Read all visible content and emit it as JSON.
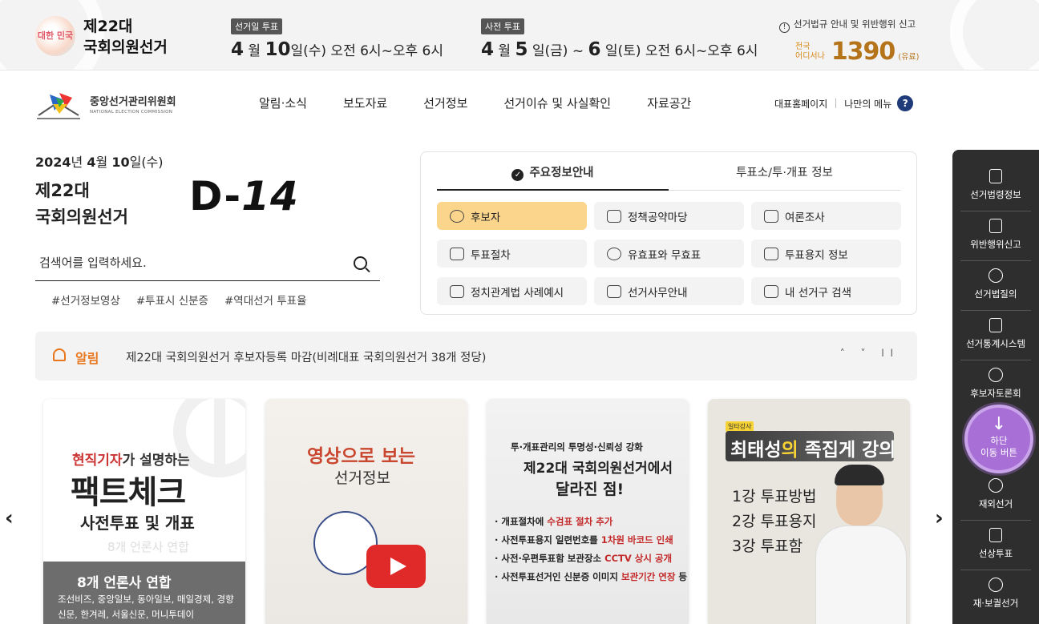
{
  "topbar": {
    "badge_text": "대한 민국",
    "election_line1": "제22대",
    "election_line2": "국회의원선거",
    "vote_day": {
      "tag": "선거일 투표",
      "month": "4",
      "month_unit": "월",
      "day": "10",
      "day_rest": "일(수) 오전 6시~오후 6시"
    },
    "early_vote": {
      "tag": "사전 투표",
      "month": "4",
      "month_unit": "월",
      "day_start": "5",
      "mid": "일(금) ~",
      "day_end": "6",
      "day_end_rest": "일(토) 오전 6시~오후 6시"
    },
    "hotline": {
      "info": "선거법규 안내 및 위반행위 신고",
      "small1": "전국",
      "small2": "어디서나",
      "number": "1390",
      "fee": "(유료)"
    }
  },
  "nav": {
    "logo_ko": "중앙선거관리위원회",
    "logo_en": "NATIONAL ELECTION COMMISSION",
    "menu": [
      "알림·소식",
      "보도자료",
      "선거정보",
      "선거이슈 및 사실확인",
      "자료공간"
    ],
    "util_home": "대표홈페이지",
    "util_mymenu": "나만의 메뉴",
    "util_help": "?"
  },
  "hero": {
    "date_bold1": "2024",
    "date_unit1": "년",
    "date_bold2": "4",
    "date_unit2": "월",
    "date_bold3": "10",
    "date_unit3": "일(수)",
    "election_line1": "제22대",
    "election_line2": "국회의원선거",
    "dday_prefix": "D-",
    "dday_num": "14",
    "search_placeholder": "검색어를 입력하세요.",
    "tags": [
      "#선거정보영상",
      "#투표시 신분증",
      "#역대선거 투표율"
    ]
  },
  "info_box": {
    "tabs": [
      "주요정보안내",
      "투표소/투·개표 정보"
    ],
    "buttons": [
      "후보자",
      "정책공약마당",
      "여론조사",
      "투표절차",
      "유효표와 무효표",
      "투표용지 정보",
      "정치관계법 사례예시",
      "선거사무안내",
      "내 선거구 검색"
    ]
  },
  "notice": {
    "label": "알림",
    "text": "제22대 국회의원선거 후보자등록 마감(비례대표 국회의원선거 38개 정당)",
    "controls": "˄ ˅ ll"
  },
  "cards": {
    "c1": {
      "sub_red": "현직기자",
      "sub_rest": "가 설명하는",
      "big": "팩트체크",
      "small": "사전투표 및 개표",
      "faint": "8개 언론사 연합",
      "grey_title": "8개 언론사 연합",
      "grey_text": "조선비즈, 중앙일보, 동아일보, 매일경제, 경향신문, 한겨레, 서울신문, 머니투데이"
    },
    "c2": {
      "h1": "영상으로 보는",
      "h2": "선거정보"
    },
    "c3": {
      "l1": "투·개표관리의 투명성·신뢰성 강화",
      "l2": "제22대 국회의원선거에서",
      "l3": "달라진 점!",
      "items": [
        {
          "pre": "개표절차에 ",
          "red": "수검표 절차 추가",
          "post": ""
        },
        {
          "pre": "사전투표용지 일련번호를 ",
          "red": "1차원 바코드 인쇄",
          "post": ""
        },
        {
          "pre": "사전·우편투표함 보관장소 ",
          "red": "CCTV 상시 공개",
          "post": ""
        },
        {
          "pre": "사전투표선거인 신분증 이미지 ",
          "red": "보관기간 연장",
          "post": " 등"
        }
      ]
    },
    "c4": {
      "tag": "일타강사",
      "name": "최태성",
      "rest_a": "의 ",
      "rest_b": "족집게 강의",
      "lectures": [
        "1강 투표방법",
        "2강 투표용지",
        "3강 투표함"
      ]
    }
  },
  "sidebar": {
    "items": [
      "선거법령정보",
      "위반행위신고",
      "선거법질의",
      "선거통계시스템",
      "후보자토론회",
      "재외선거",
      "선상투표",
      "재·보궐선거"
    ],
    "go_bottom_l1": "하단",
    "go_bottom_l2": "이동 버튼"
  },
  "arrows": {
    "prev": "‹",
    "next": "›"
  },
  "colors": {
    "accent_orange": "#e8761c",
    "active_btn": "#fbd58c",
    "sidebar_bg": "#2e2e2e",
    "go_bottom": "#a86fd6",
    "hotline": "#b5731a"
  }
}
